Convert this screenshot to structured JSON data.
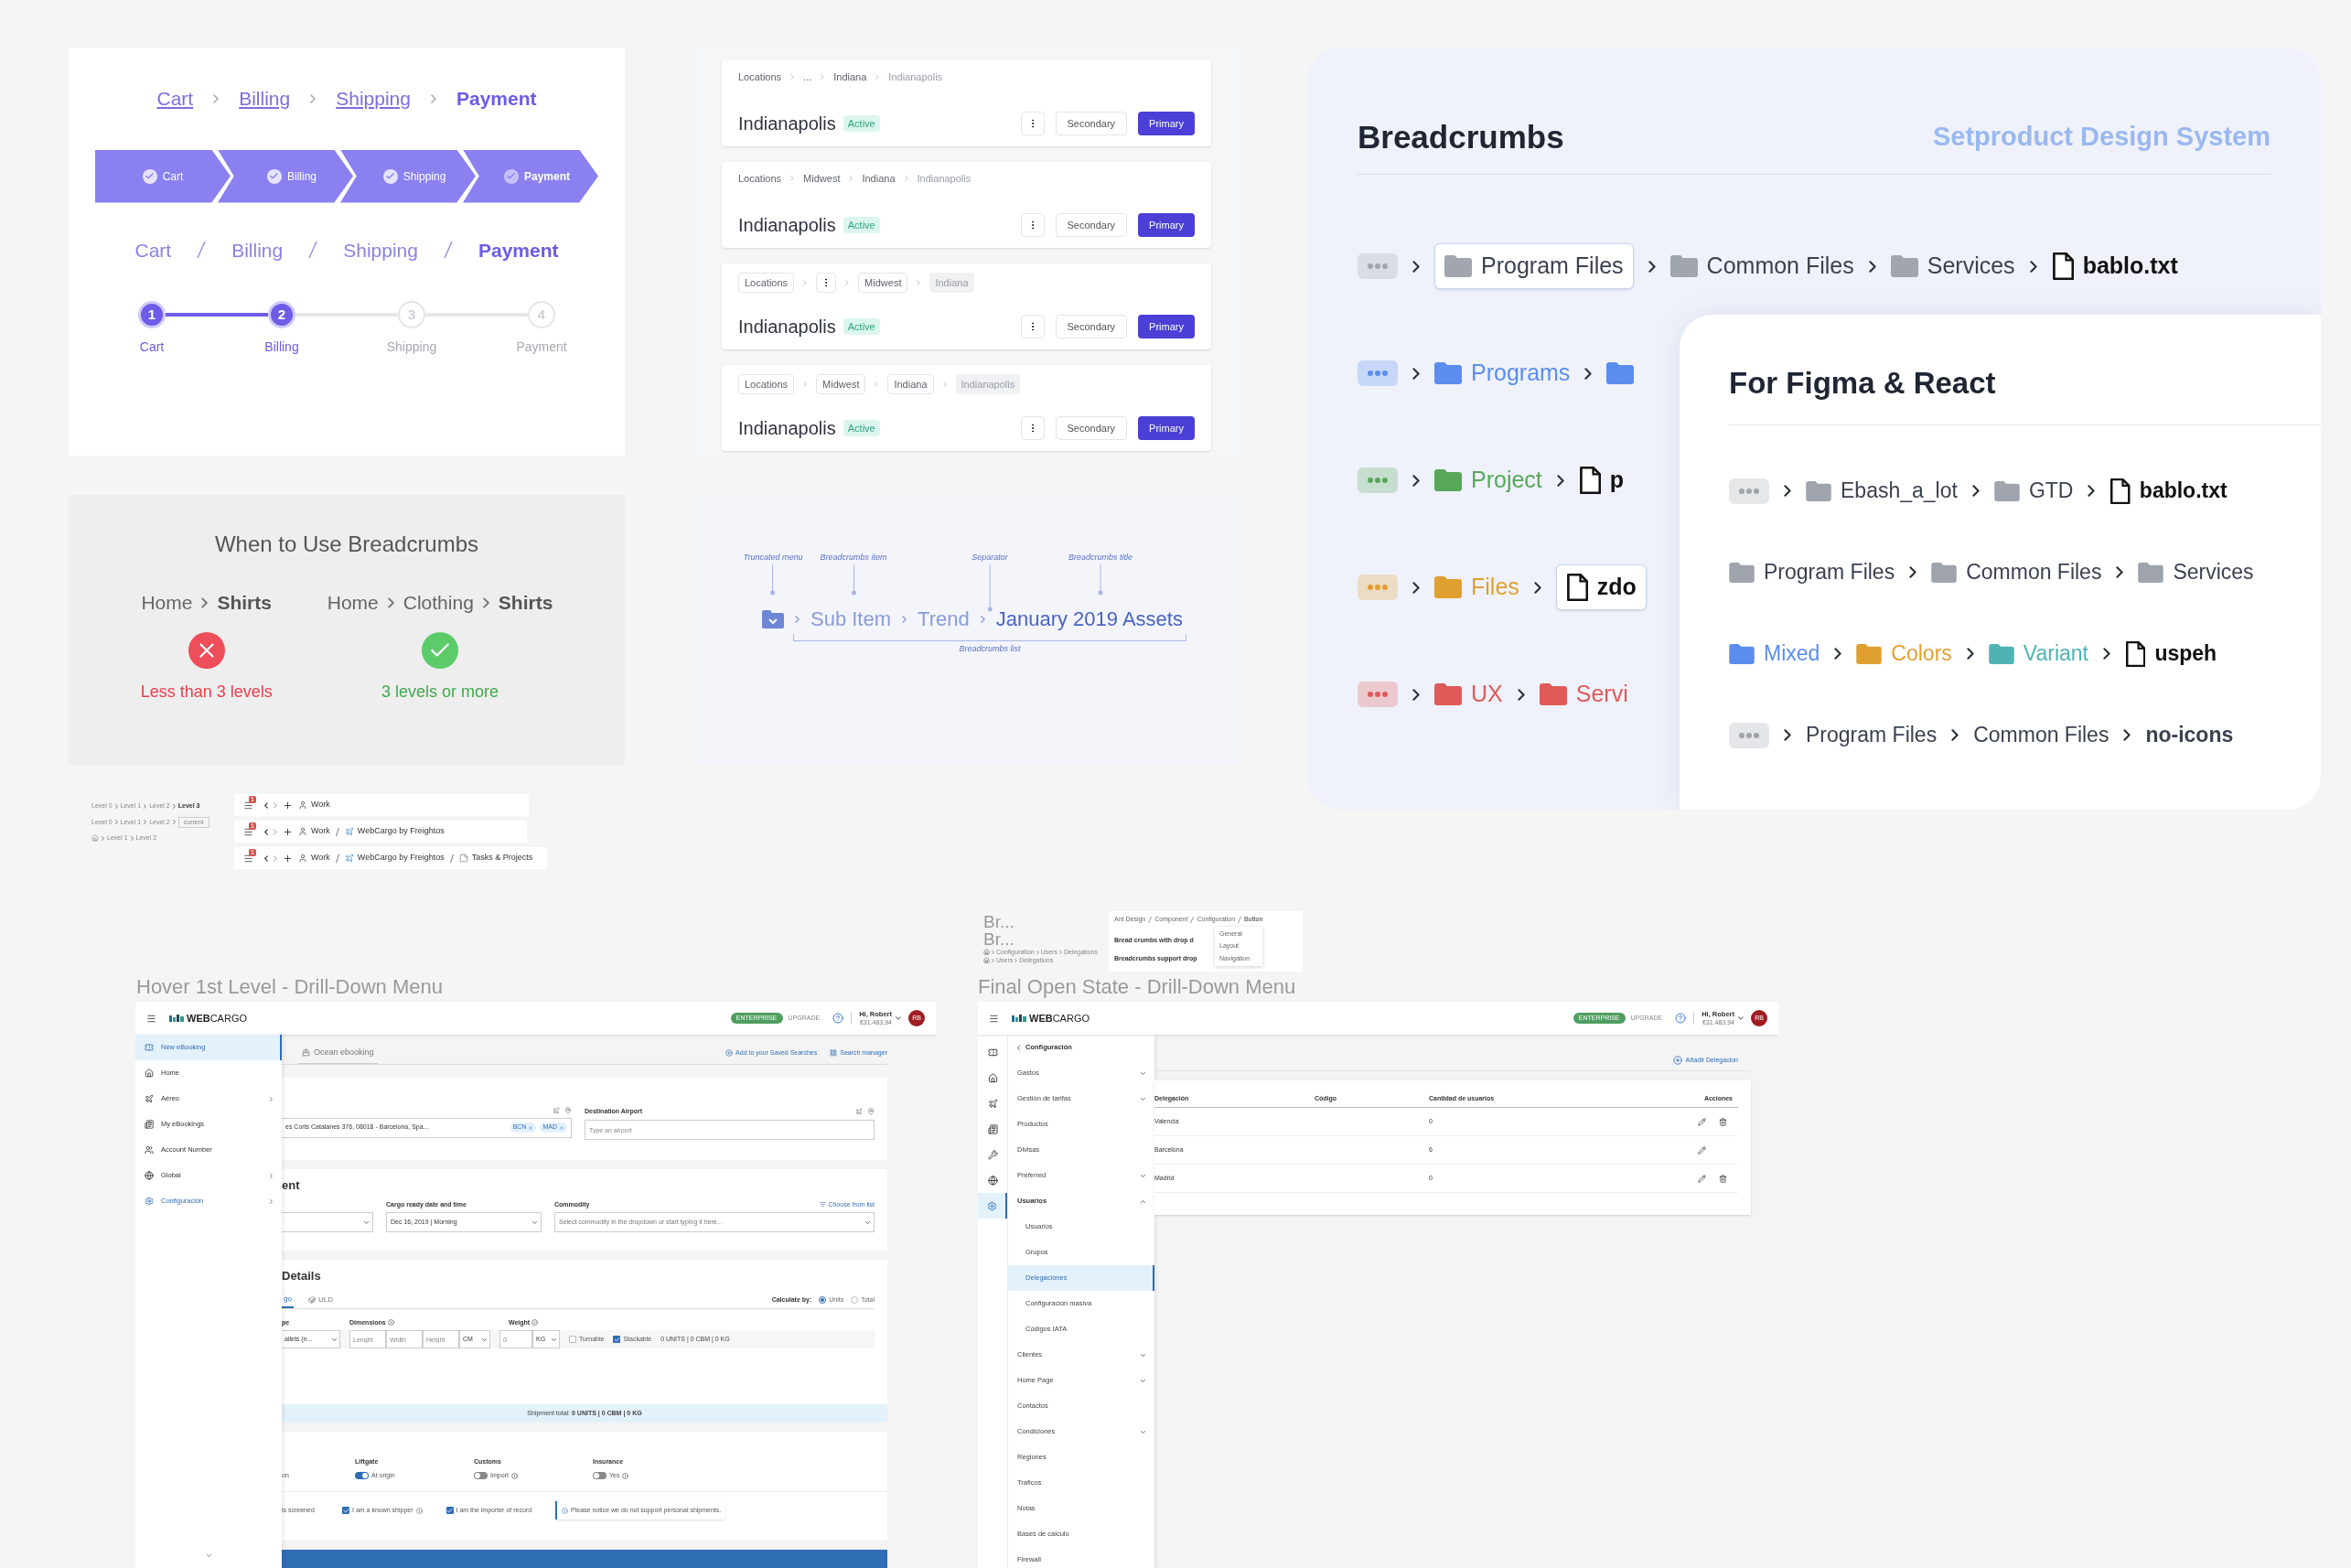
{
  "cart_flow": {
    "links": [
      {
        "label": "Cart",
        "selected": false
      },
      {
        "label": "Billing",
        "selected": false
      },
      {
        "label": "Shipping",
        "selected": false
      },
      {
        "label": "Payment",
        "selected": true
      }
    ],
    "arrows": [
      {
        "label": "Cart",
        "selected": false
      },
      {
        "label": "Billing",
        "selected": false
      },
      {
        "label": "Shipping",
        "selected": false
      },
      {
        "label": "Payment",
        "selected": true
      }
    ],
    "slashes": [
      {
        "label": "Cart",
        "selected": false
      },
      {
        "label": "Billing",
        "selected": false
      },
      {
        "label": "Shipping",
        "selected": false
      },
      {
        "label": "Payment",
        "selected": true
      }
    ],
    "stepper": [
      {
        "number": "1",
        "label": "Cart",
        "done": true
      },
      {
        "number": "2",
        "label": "Billing",
        "done": true
      },
      {
        "number": "3",
        "label": "Shipping",
        "done": false
      },
      {
        "number": "4",
        "label": "Payment",
        "done": false
      }
    ]
  },
  "location_cards": [
    {
      "kind": "plain",
      "crumbs": [
        {
          "label": "Locations",
          "kind": "link"
        },
        {
          "label": "...",
          "kind": "link"
        },
        {
          "label": "Indiana",
          "kind": "link"
        },
        {
          "label": "Indianapolis",
          "kind": "current"
        }
      ],
      "title": "Indianapolis",
      "badge": "Active",
      "secondary": "Secondary",
      "primary": "Primary"
    },
    {
      "kind": "plain",
      "crumbs": [
        {
          "label": "Locations",
          "kind": "link"
        },
        {
          "label": "Midwest",
          "kind": "link"
        },
        {
          "label": "Indiana",
          "kind": "link"
        },
        {
          "label": "Indianapolis",
          "kind": "current"
        }
      ],
      "title": "Indianapolis",
      "badge": "Active",
      "secondary": "Secondary",
      "primary": "Primary"
    },
    {
      "kind": "chip",
      "crumbs": [
        {
          "label": "Locations",
          "kind": "link"
        },
        {
          "kind": "menu"
        },
        {
          "label": "Midwest",
          "kind": "link"
        },
        {
          "label": "Indiana",
          "kind": "current"
        }
      ],
      "title": "Indianapolis",
      "badge": "Active",
      "secondary": "Secondary",
      "primary": "Primary"
    },
    {
      "kind": "chip",
      "crumbs": [
        {
          "label": "Locations",
          "kind": "link"
        },
        {
          "label": "Midwest",
          "kind": "link"
        },
        {
          "label": "Indiana",
          "kind": "link"
        },
        {
          "label": "Indianapolis",
          "kind": "current"
        }
      ],
      "title": "Indianapolis",
      "badge": "Active",
      "secondary": "Secondary",
      "primary": "Primary"
    }
  ],
  "setproduct": {
    "title": "Breadcrumbs",
    "brand": "Setproduct Design System",
    "rows": [
      {
        "color": "#a0a5ae",
        "tinted": false,
        "more": true,
        "crumbs": [
          {
            "label": "Program Files",
            "kind": "folder",
            "selected": true
          },
          {
            "label": "Common Files",
            "kind": "folder",
            "selected": false
          },
          {
            "label": "Services",
            "kind": "folder",
            "selected": false
          },
          {
            "label": "bablo.txt",
            "kind": "file",
            "selected": false
          }
        ]
      },
      {
        "color": "#5b8def",
        "tinted": true,
        "more": true,
        "crumbs": [
          {
            "label": "Programs",
            "kind": "folder",
            "selected": false
          },
          {
            "kind": "folder",
            "selected": false
          }
        ]
      },
      {
        "color": "#58a85a",
        "tinted": true,
        "more": true,
        "crumbs": [
          {
            "label": "Project",
            "kind": "folder",
            "selected": false
          },
          {
            "label": "p",
            "kind": "file",
            "selected": false
          }
        ]
      },
      {
        "color": "#e0a030",
        "tinted": true,
        "more": true,
        "crumbs": [
          {
            "label": "Files",
            "kind": "folder",
            "selected": false
          },
          {
            "label": "zdo",
            "kind": "file",
            "selected": true
          }
        ]
      },
      {
        "color": "#e05a5a",
        "tinted": true,
        "more": true,
        "crumbs": [
          {
            "label": "UX",
            "kind": "folder",
            "selected": false
          },
          {
            "label": "Servi",
            "kind": "folder",
            "selected": false
          }
        ]
      }
    ],
    "inner": {
      "title": "For Figma & React",
      "rows": [
        {
          "color": "#9fa4ad",
          "tinted": false,
          "more": true,
          "crumbs": [
            {
              "label": "Ebash_a_lot",
              "kind": "folder"
            },
            {
              "label": "GTD",
              "kind": "folder"
            },
            {
              "label": "bablo.txt",
              "kind": "file"
            }
          ]
        },
        {
          "color": "#9ea3ac",
          "tinted": false,
          "more": false,
          "crumbs": [
            {
              "label": "Program Files",
              "kind": "folder"
            },
            {
              "label": "Common Files",
              "kind": "folder"
            },
            {
              "label": "Services",
              "kind": "folder"
            }
          ]
        },
        {
          "tinted": true,
          "more": false,
          "crumbs": [
            {
              "label": "Mixed",
              "kind": "folder",
              "color": "#5b8def"
            },
            {
              "label": "Colors",
              "kind": "folder",
              "color": "#e0a030"
            },
            {
              "label": "Variant",
              "kind": "folder",
              "color": "#4fb3b3"
            },
            {
              "label": "uspeh",
              "kind": "file"
            }
          ]
        },
        {
          "color": "#9da2ab",
          "tinted": false,
          "more": true,
          "crumbs": [
            {
              "label": "Program Files",
              "kind": "text"
            },
            {
              "label": "Common Files",
              "kind": "text"
            },
            {
              "label": "no-icons",
              "kind": "text"
            }
          ]
        }
      ]
    }
  },
  "usage": {
    "title": "When to Use Breadcrumbs",
    "examples": [
      {
        "crumbs": [
          {
            "label": "Home",
            "current": false
          },
          {
            "label": "Shirts",
            "current": true
          }
        ],
        "ok": false,
        "verdict": "Less than 3 levels"
      },
      {
        "crumbs": [
          {
            "label": "Home",
            "current": false
          },
          {
            "label": "Clothing",
            "current": false
          },
          {
            "label": "Shirts",
            "current": true
          }
        ],
        "ok": true,
        "verdict": "3 levels or more"
      }
    ]
  },
  "anatomy": {
    "callouts": [
      "Truncated menu",
      "Breadcrumbs item",
      "Separator",
      "Breadcrumbs title"
    ],
    "items": [
      "Sub Item",
      "Trend"
    ],
    "title": "January 2019 Assets",
    "list_label": "Breadcrumbs list"
  },
  "levels_mini": [
    {
      "home": false,
      "crumbs": [
        {
          "label": "Level 0",
          "kind": "link"
        },
        {
          "label": "Level 1",
          "kind": "link"
        },
        {
          "label": "Level 2",
          "kind": "link"
        },
        {
          "label": "Level 3",
          "kind": "current"
        }
      ]
    },
    {
      "home": false,
      "crumbs": [
        {
          "label": "Level 0",
          "kind": "link"
        },
        {
          "label": "Level 1",
          "kind": "link"
        },
        {
          "label": "Level 2",
          "kind": "link"
        },
        {
          "label": "current",
          "kind": "input"
        }
      ]
    },
    {
      "home": true,
      "crumbs": [
        {
          "label": "Level 1",
          "kind": "link"
        },
        {
          "label": "Level 2",
          "kind": "link"
        }
      ]
    }
  ],
  "tab_bars": [
    {
      "badge": "1",
      "crumbs": [
        {
          "label": "Work",
          "kind": "person"
        }
      ]
    },
    {
      "badge": "1",
      "crumbs": [
        {
          "label": "Work",
          "kind": "person"
        },
        {
          "label": "WebCargo by Freightos",
          "kind": "plane"
        }
      ]
    },
    {
      "badge": "1",
      "crumbs": [
        {
          "label": "Work",
          "kind": "person"
        },
        {
          "label": "WebCargo by Freightos",
          "kind": "plane"
        },
        {
          "label": "Tasks & Projects",
          "kind": "note"
        }
      ]
    }
  ],
  "hover_screen": {
    "title": "Hover 1st Level - Drill-Down Menu",
    "header": {
      "brand": "**WEB**CARGO",
      "plan": "ENTERPRISE",
      "upgrade": "UPGRADE",
      "greeting": "Hi, Robert",
      "balance": "€31.483,94",
      "initials": "RB"
    },
    "menu": [
      {
        "label": "New eBooking",
        "kind": "ticket",
        "selected": true,
        "active": true,
        "submenu": false
      },
      {
        "label": "Home",
        "kind": "home",
        "selected": false,
        "active": false,
        "submenu": false
      },
      {
        "label": "Aéreo",
        "kind": "plane",
        "selected": false,
        "active": false,
        "submenu": true
      },
      {
        "label": "My eBookings",
        "kind": "book",
        "selected": false,
        "active": false,
        "submenu": false
      },
      {
        "label": "Account Number",
        "kind": "users",
        "selected": false,
        "active": false,
        "submenu": false
      },
      {
        "label": "Global",
        "kind": "globe",
        "selected": false,
        "active": false,
        "submenu": true
      },
      {
        "label": "Configuración",
        "kind": "gear",
        "selected": false,
        "active": true,
        "submenu": true
      }
    ],
    "tab": "Ocean ebooking",
    "links": [
      "Add to your Saved Searches",
      "Search manager"
    ],
    "route": {
      "origin": "es Corts Catalanes 376, 08018 - Barcelona, Spa...",
      "chips": [
        "BCN",
        "MAD"
      ],
      "destination": {
        "label": "Destination Airport",
        "placeholder": "Type an airport"
      }
    },
    "shipment": {
      "heading": "ent",
      "date_label": "Cargo ready date and time",
      "date": "Dec 16, 2019 | Morning",
      "commodity": {
        "label": "Commodity",
        "placeholder": "Select commodity in the dropdown or start typing it here..."
      },
      "choose": "Choose from list"
    },
    "details": {
      "heading": "Details",
      "tabs": [
        {
          "label": "go",
          "selected": true
        },
        {
          "label": "ULD",
          "selected": false
        }
      ],
      "calc_label": "Calculate by:",
      "calc": [
        {
          "label": "Units",
          "selected": true
        },
        {
          "label": "Total",
          "selected": false
        }
      ],
      "type_label": "pe",
      "type_value": "allets (n...",
      "dims_label": "Dimensions",
      "dims": [
        {
          "placeholder": "Lenght"
        },
        {
          "placeholder": "Width"
        },
        {
          "placeholder": "Height"
        }
      ],
      "unit": "CM",
      "weight": {
        "label": "Weight",
        "placeholder": "0"
      },
      "weight_unit": "KG",
      "checks": [
        {
          "label": "Turnable",
          "checked": false
        },
        {
          "label": "Stackable",
          "checked": true
        }
      ],
      "summary": "0 UNITS | 0 CBM | 0 KG",
      "total": "Shipment total: **0 UNITS | 0 CBM | 0 KG**"
    },
    "extras": {
      "cut_label": "on",
      "toggles": [
        {
          "label": "Liftgate",
          "value": "At origin",
          "on": true,
          "info": false
        },
        {
          "label": "Customs",
          "value": "Import",
          "on": false,
          "info": true
        },
        {
          "label": "Insurance",
          "value": "Yes",
          "on": false,
          "info": true
        }
      ],
      "cut_check": "is screened",
      "checks": [
        {
          "label": "I am a known shipper",
          "checked": true,
          "info": true
        },
        {
          "label": "I am the importer of record",
          "checked": true,
          "info": false
        }
      ],
      "notice": "Please notice we do not support personal shipments."
    }
  },
  "final_screen": {
    "title": "Final Open State - Drill-Down Menu",
    "truncated": [
      "Br...",
      "Br..."
    ],
    "mini_crumbs": [
      {
        "home": true,
        "crumbs": [
          "Configuration",
          "Users",
          "Delegations"
        ]
      },
      {
        "home": true,
        "crumbs": [
          "Users",
          "Delegations"
        ]
      }
    ],
    "ant_card": {
      "crumbs": [
        "Ant Design",
        "Component",
        "Configuration",
        "Button"
      ],
      "lines": [
        "Bread crumbs with drop d",
        "Breadcrumbs support drop"
      ],
      "dropdown": [
        "General",
        "Layout",
        "Navigation"
      ]
    },
    "header": {
      "brand": "**WEB**CARGO",
      "plan": "ENTERPRISE",
      "upgrade": "UPGRADE",
      "greeting": "Hi, Robert",
      "balance": "€31.483,94",
      "initials": "RB"
    },
    "rail": [
      {
        "kind": "ticket",
        "selected": false
      },
      {
        "kind": "home",
        "selected": false
      },
      {
        "kind": "plane",
        "selected": false
      },
      {
        "kind": "book",
        "selected": false
      },
      {
        "kind": "wrench",
        "selected": false
      },
      {
        "kind": "globe",
        "selected": false
      },
      {
        "kind": "gear",
        "selected": true
      }
    ],
    "panel_title": "Configuración",
    "menu": [
      {
        "label": "Gastos",
        "expandable": true,
        "expanded": false
      },
      {
        "label": "Gestión de tarifas",
        "expandable": true,
        "expanded": false
      },
      {
        "label": "Productos",
        "expandable": false,
        "expanded": false
      },
      {
        "label": "Divisas",
        "expandable": false,
        "expanded": false
      },
      {
        "label": "Preferred",
        "expandable": true,
        "expanded": false
      },
      {
        "label": "Usuarios",
        "expandable": true,
        "expanded": true,
        "children": [
          {
            "label": "Usuarios",
            "selected": false
          },
          {
            "label": "Grupos",
            "selected": false
          },
          {
            "label": "Delegaciones",
            "selected": true
          },
          {
            "label": "Configuración masiva",
            "selected": false
          },
          {
            "label": "Códigos IATA",
            "selected": false
          }
        ]
      },
      {
        "label": "Clientes",
        "expandable": true,
        "expanded": false
      },
      {
        "label": "Home Page",
        "expandable": true,
        "expanded": false
      },
      {
        "label": "Contactos",
        "expandable": false,
        "expanded": false
      },
      {
        "label": "Condiciones",
        "expandable": true,
        "expanded": false
      },
      {
        "label": "Regiones",
        "expandable": false,
        "expanded": false
      },
      {
        "label": "Traficos",
        "expandable": false,
        "expanded": false
      },
      {
        "label": "Notas",
        "expandable": false,
        "expanded": false
      },
      {
        "label": "Bases de calculo",
        "expandable": false,
        "expanded": false
      },
      {
        "label": "Firewall",
        "expandable": false,
        "expanded": false
      }
    ],
    "add_link": "Añadir Delegacion",
    "table": {
      "columns": [
        "Delegación",
        "Código",
        "Cantidad de usuarios",
        "Acciones"
      ],
      "rows": [
        {
          "name": "Valencia",
          "count": "0",
          "deletable": true
        },
        {
          "name": "Barcelona",
          "count": "6",
          "deletable": false
        },
        {
          "name": "Madrid",
          "count": "0",
          "deletable": true
        }
      ]
    }
  }
}
